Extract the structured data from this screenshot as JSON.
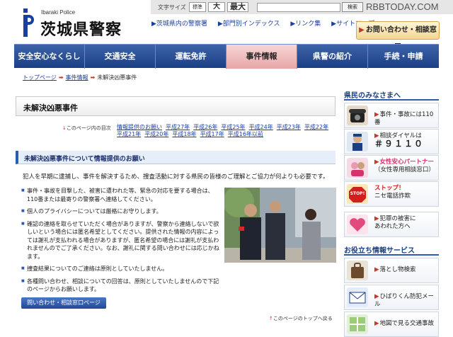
{
  "header": {
    "logo_sub": "Ibaraki Police",
    "logo_main": "茨城県警察",
    "font_size_label": "文字サイズ",
    "font_std": "標準",
    "font_large": "大",
    "font_max": "最大",
    "search_button": "検索",
    "watermark": "RBBTODAY.COM",
    "util_links": [
      "茨城県内の警察署",
      "部門別インデックス",
      "リンク集",
      "サイトマップ"
    ],
    "contact_button": "お問い合わせ・相談窓口"
  },
  "nav": {
    "items": [
      "安全安心なくらし",
      "交通安全",
      "運転免許",
      "事件情報",
      "県警の紹介",
      "手続・申請"
    ],
    "active_index": 3
  },
  "breadcrumb": {
    "items": [
      "トップページ",
      "事件情報",
      "未解決凶悪事件"
    ]
  },
  "main": {
    "title": "未解決凶悪事件",
    "toc_label": "このページ内の目次",
    "toc_links": [
      "情報提供のお願い",
      "平成27年",
      "平成26年",
      "平成25年",
      "平成24年",
      "平成23年",
      "平成22年",
      "平成21年",
      "平成20年",
      "平成18年",
      "平成17年",
      "平成16年以前"
    ],
    "section_title": "未解決凶悪事件について情報提供のお願い",
    "intro": "犯人を早期に逮捕し、事件を解決するため、捜査活動に対する県民の皆様のご理解とご協力が何よりも必要です。",
    "bullets": [
      "事件・事故を目撃した、被害に遭われた等、緊急の対応を要する場合は、110番または最寄りの警察署へ連絡してください。",
      "個人のプライバシーについては厳格にお守りします。",
      "確認の連絡を取らせていただく場合がありますが、警察から連絡しないで欲しいという場合には匿名希望としてください。提供された情報の内容によっては謝礼が支払われる場合がありますが、匿名希望の場合には謝礼が支払われませんのでご了承ください。なお、謝礼に関する問い合わせには応じかねます。",
      "捜査結果についてのご連絡は原則としていたしません。",
      "各種問い合わせ、相談についての回答は、原則としていたしませんので下記のページからお願いします。"
    ],
    "inquiry_button": "問い合わせ・相談窓口ページ",
    "page_top": "このページのトップへ戻る"
  },
  "sidebar": {
    "head1": "県民のみなさまへ",
    "card1": "事件・事故には110番",
    "card2_line1": "相談ダイヤルは",
    "card2_num": "＃９１１０",
    "card3_line1": "女性安心パートナー",
    "card3_line2": "（女性専用相談窓口）",
    "card4_line1": "ストップ！",
    "card4_line2": "ニセ電話詐欺",
    "card4_stop": "STOP!",
    "card5_line1": "犯罪の被害に",
    "card5_line2": "あわれた方へ",
    "head2": "お役立ち情報サービス",
    "card6": "落とし物検索",
    "card7": "ひばりくん防犯メール",
    "card8": "地図で見る交通事故"
  }
}
